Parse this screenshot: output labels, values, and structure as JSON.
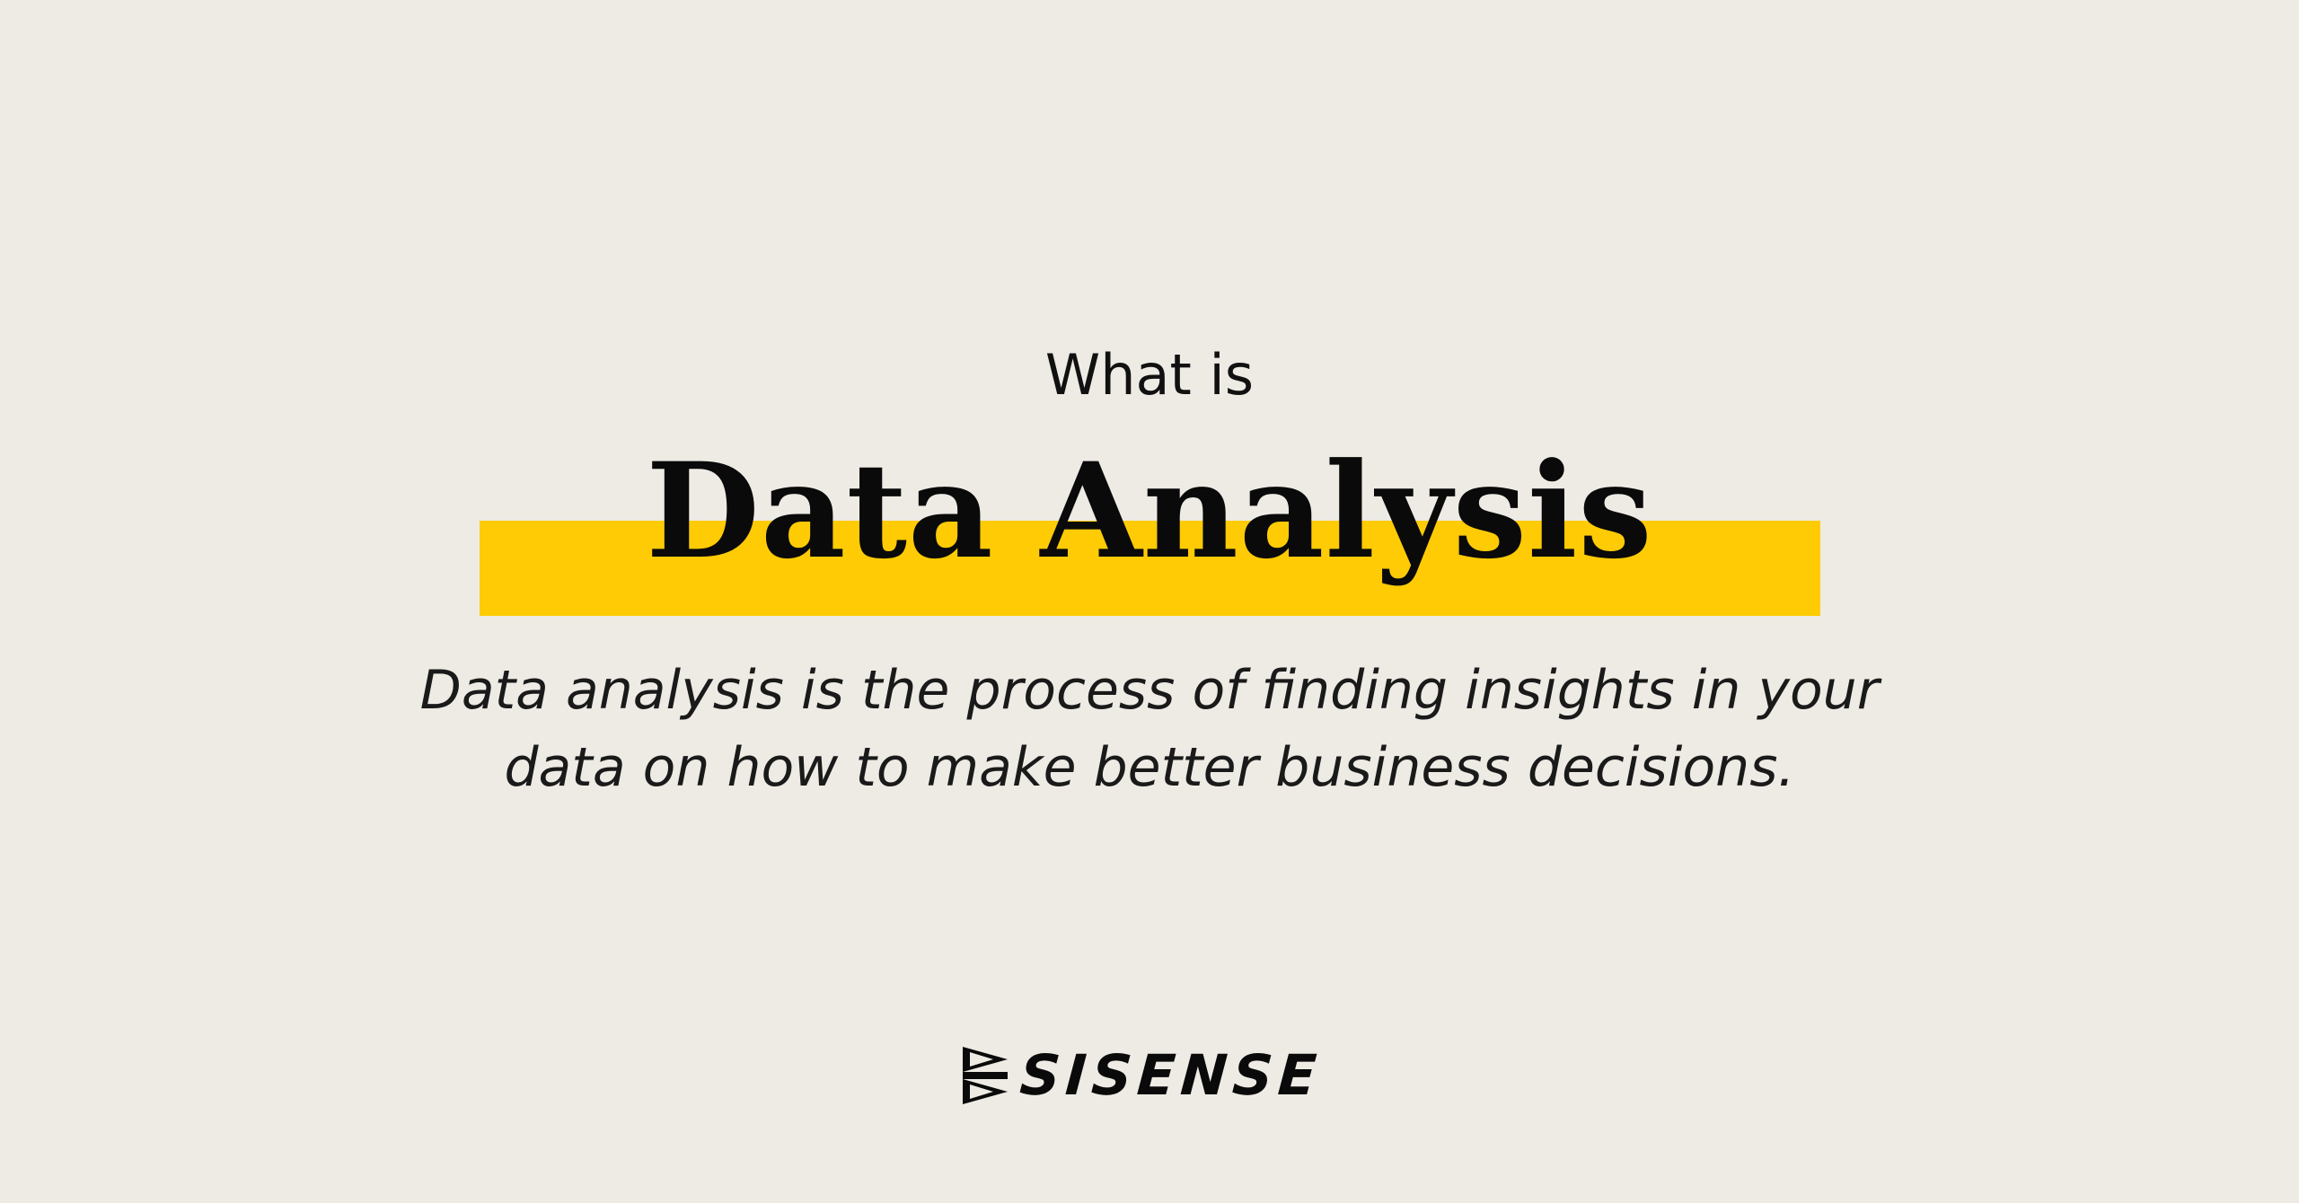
{
  "header": {
    "eyebrow": "What is",
    "title": "Data Analysis"
  },
  "body": {
    "description": "Data analysis is the process of finding insights in your data on how to make better business decisions."
  },
  "brand": {
    "logo_icon": "sisense-logo-mark-icon",
    "name": "SISENSE"
  },
  "colors": {
    "background": "#eeebe5",
    "highlight": "#fecb05",
    "text": "#0d0d0d"
  }
}
